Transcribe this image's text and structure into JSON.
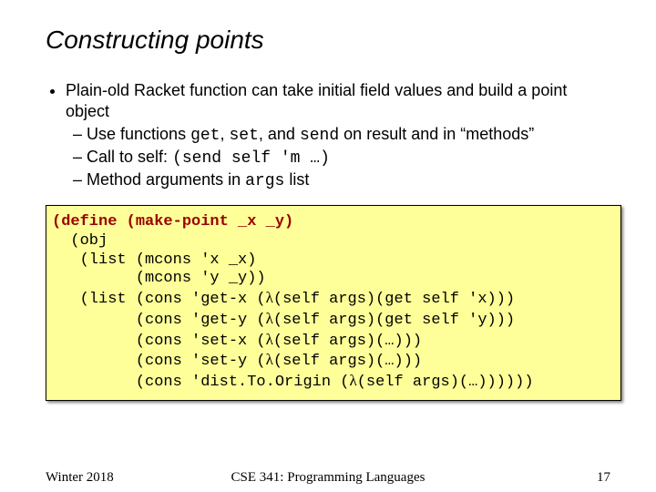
{
  "title": "Constructing points",
  "bullets": {
    "top": "Plain-old Racket function can take initial field values and build a point object",
    "sub1_a": "Use functions ",
    "sub1_get": "get",
    "sub1_b": ", ",
    "sub1_set": "set",
    "sub1_c": ", and ",
    "sub1_send": "send",
    "sub1_d": " on result and in “methods”",
    "sub2_a": "Call to self: ",
    "sub2_code": "(send self 'm …)",
    "sub3_a": "Method arguments in ",
    "sub3_code": "args",
    "sub3_b": " list"
  },
  "code": {
    "l1a": "(define (make-point _x _y)",
    "l2": "  (obj",
    "l3": "   (list (mcons 'x _x)",
    "l4": "         (mcons 'y _y))",
    "l5a": "   (list (cons 'get-x (",
    "l5b": "(self args)(get self 'x)))",
    "l6a": "         (cons 'get-y (",
    "l6b": "(self args)(get self 'y)))",
    "l7a": "         (cons 'set-x (",
    "l7b": "(self args)(…)))",
    "l8a": "         (cons 'set-y (",
    "l8b": "(self args)(…)))",
    "l9a": "         (cons 'dist.To.Origin (",
    "l9b": "(self args)(…))))))",
    "lambda": "λ"
  },
  "footer": {
    "left": "Winter 2018",
    "center": "CSE 341: Programming Languages",
    "right": "17"
  }
}
